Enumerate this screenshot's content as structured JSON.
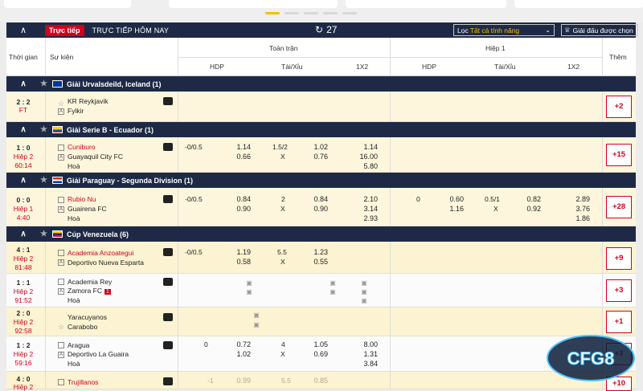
{
  "header": {
    "live_badge": "Trực tiếp",
    "title": "TRỰC TIẾP HÔM NAY",
    "live_count": "27",
    "filter_label": "Lọc",
    "filter_value": "Tất cả tính năng",
    "league_select": "Giải đấu được chọn"
  },
  "columns": {
    "time": "Thời gian",
    "event": "Sự kiện",
    "fulltime": "Toàn trận",
    "half1": "Hiệp 1",
    "hdp": "HDP",
    "ou": "Tài/Xỉu",
    "x12": "1X2",
    "more": "Thêm"
  },
  "leagues": [
    {
      "name": "Giải Urvalsdeild, Iceland (1)"
    },
    {
      "name": "Giải Serie B - Ecuador (1)"
    },
    {
      "name": "Giải Paraguay - Segunda Division (1)"
    },
    {
      "name": "Cúp Venezuela (6)"
    }
  ],
  "matches": [
    {
      "score": "2 : 2",
      "status": "FT",
      "clock": "",
      "home": "KR Reykjavik",
      "away": "Fylkir",
      "draw": "",
      "more": "+2"
    },
    {
      "score": "1 : 0",
      "status": "Hiệp 2",
      "clock": "60:14",
      "home": "Cuniburo",
      "away": "Guayaquil City FC",
      "draw": "Hoà",
      "more": "+15",
      "ft": {
        "hdp": "-0/0.5",
        "h1": "1.14",
        "h2": "0.66",
        "ou": "1.5/2",
        "ouX": "X",
        "o1": "1.02",
        "o2": "0.76",
        "x1": "1.14",
        "x2": "16.00",
        "x3": "5.80"
      }
    },
    {
      "score": "0 : 0",
      "status": "Hiệp 1",
      "clock": "4:40",
      "home": "Rubio Nu",
      "away": "Guairena FC",
      "draw": "Hoà",
      "more": "+28",
      "ft": {
        "hdp": "-0/0.5",
        "h1": "0.84",
        "h2": "0.90",
        "ou": "2",
        "ouX": "X",
        "o1": "0.84",
        "o2": "0.90",
        "x1": "2.10",
        "x2": "3.14",
        "x3": "2.93"
      },
      "h1": {
        "hdp": "0",
        "h1": "0.60",
        "h2": "1.16",
        "ou": "0.5/1",
        "ouX": "X",
        "o1": "0.82",
        "o2": "0.92",
        "x1": "2.89",
        "x2": "3.76",
        "x3": "1.86"
      }
    },
    {
      "score": "4 : 1",
      "status": "Hiệp 2",
      "clock": "81:48",
      "home": "Academia Anzoategui",
      "away": "Deportivo Nueva Esparta",
      "draw": "",
      "more": "+9",
      "ft": {
        "hdp": "-0/0.5",
        "h1": "1.19",
        "h2": "0.58",
        "ou": "5.5",
        "ouX": "X",
        "o1": "1.23",
        "o2": "0.55"
      }
    },
    {
      "score": "1 : 1",
      "status": "Hiệp 2",
      "clock": "91:52",
      "home": "Academia Rey",
      "away": "Zamora FC",
      "draw": "Hoà",
      "redcard": "1",
      "more": "+3"
    },
    {
      "score": "2 : 0",
      "status": "Hiệp 2",
      "clock": "92:58",
      "home": "Yaracuyanos",
      "away": "Carabobo",
      "draw": "",
      "more": "+1"
    },
    {
      "score": "1 : 2",
      "status": "Hiệp 2",
      "clock": "59:16",
      "home": "Aragua",
      "away": "Deportivo La Guaira",
      "draw": "Hoà",
      "more": "+3",
      "ft": {
        "hdp": "0",
        "h1": "0.72",
        "h2": "1.02",
        "ou": "4",
        "ouX": "X",
        "o1": "1.05",
        "o2": "0.69",
        "x1": "8.00",
        "x2": "1.31",
        "x3": "3.84"
      }
    },
    {
      "score": "4 : 0",
      "status": "Hiệp 2",
      "clock": "",
      "home": "Trujillanos",
      "away": "",
      "draw": "",
      "more": "+10",
      "ft": {
        "hdp": "-1",
        "h1": "0.99",
        "h2": "0.75",
        "ou": "5.5",
        "o1": "0.85",
        "o2": "0.99"
      }
    }
  ],
  "logo": {
    "text": "CFG8"
  }
}
